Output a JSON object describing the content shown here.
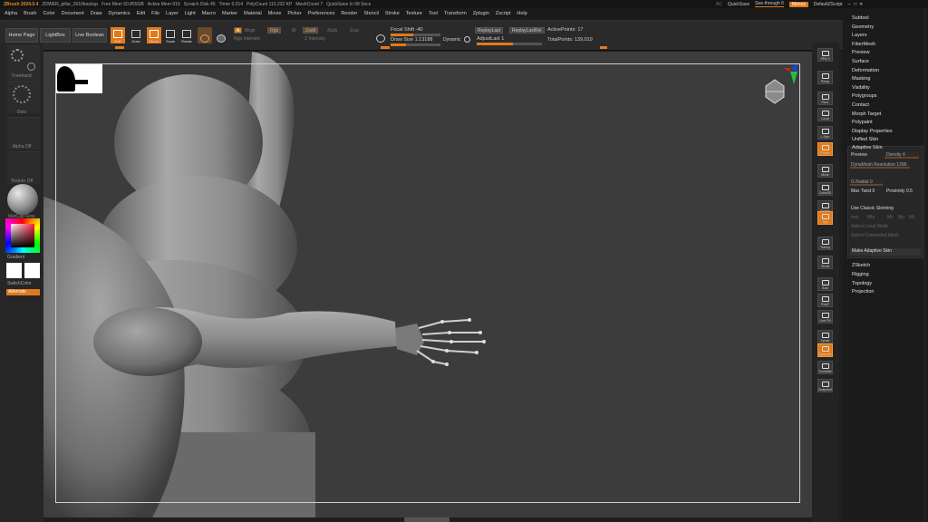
{
  "titlebar": {
    "app": "ZBrush 2024.0.4",
    "file": "ZDWER_pillar_0010backup",
    "free_mem": "Free Mem 50.855GB",
    "active_mem": "Active Mem 919",
    "scratch": "Scratch Disk 45",
    "timer": "Timer 0.014",
    "polycount": "PolyCount 113.232 KP",
    "meshcount": "MeshCount 7",
    "quicksave": "QuickSave In 58 Secs"
  },
  "topright": {
    "ac": "AC",
    "quicksave": "QuickSave",
    "seethrough": "See-through 0",
    "menus": "Menus",
    "script": "DefaultZScript"
  },
  "menubar": [
    "Alpha",
    "Brush",
    "Color",
    "Document",
    "Draw",
    "Dynamics",
    "Edit",
    "File",
    "Layer",
    "Light",
    "Macro",
    "Marker",
    "Material",
    "Movie",
    "Picker",
    "Preferences",
    "Render",
    "Stencil",
    "Stroke",
    "Texture",
    "Tool",
    "Transform",
    "Zplugin",
    "Zscript",
    "Help"
  ],
  "shelf": {
    "home_page": "Home Page",
    "lightbox": "LightBox",
    "live_boolean": "Live Boolean",
    "tools": [
      {
        "label": "Edit",
        "on": true
      },
      {
        "label": "Draw",
        "on": false
      },
      {
        "label": "Move",
        "on": true
      },
      {
        "label": "Scale",
        "on": false
      },
      {
        "label": "Rotate",
        "on": false
      }
    ],
    "mode_a": "A",
    "mrgb": "Mrgb",
    "rgb": "Rgb",
    "m": "M",
    "zadd": "Zadd",
    "zsub": "Zsub",
    "zcut": "Zcut",
    "rgb_intensity": "Rgb Intensity",
    "z_intensity": "Z Intensity",
    "focal_shift": "Focal Shift -40",
    "draw_size": "Draw Size 1.13188",
    "dynamic": "Dynamic",
    "replay_last": "ReplayLast",
    "replay_last_rel": "ReplayLastRel",
    "adjust_last": "AdjustLast 1",
    "active_points": "ActivePoints: 17",
    "total_points": "TotalPoints: 139,019",
    "focal_fill": 0.45,
    "draw_fill": 0.3,
    "adjust_fill": 0.55
  },
  "lefttray": {
    "stroke": "Freehand",
    "dots": "Dots",
    "alpha": "Alpha Off",
    "texture": "Texture Off",
    "material": "MatCap Gray",
    "gradient": "Gradient",
    "switch_color": "SwitchColor",
    "alternate": "Alternate"
  },
  "righticons": [
    {
      "label": "SPix 3",
      "on": false
    },
    {
      "label": "Persp",
      "on": false
    },
    {
      "label": "Floor",
      "on": false
    },
    {
      "label": "Local",
      "on": false
    },
    {
      "label": "L.Sym",
      "on": false
    },
    {
      "label": "Frame",
      "on": true
    },
    {
      "label": "Move",
      "on": false
    },
    {
      "label": "Zoom3D",
      "on": false
    },
    {
      "label": "Rotate",
      "on": false
    },
    {
      "label": "Xyz",
      "on": true
    },
    {
      "label": "Transp",
      "on": false
    },
    {
      "label": "Ghost",
      "on": false
    },
    {
      "label": "Solo",
      "on": false
    },
    {
      "label": "PolyF",
      "on": false
    },
    {
      "label": "Line Fill",
      "on": false
    },
    {
      "label": "Xpose",
      "on": false
    },
    {
      "label": "Dynamic",
      "on": true
    },
    {
      "label": "Turntable",
      "on": false
    },
    {
      "label": "Snapshot",
      "on": false
    }
  ],
  "rightpanel": {
    "items_top": [
      "Subtool",
      "Geometry",
      "Layers",
      "FiberMesh",
      "Preview",
      "Surface",
      "Deformation",
      "Masking",
      "Visibility",
      "Polygroups",
      "Contact",
      "Morph Target",
      "Polypaint",
      "Display Properties",
      "Unified Skin",
      "Adaptive Skin"
    ],
    "skin": {
      "preview": "Preview",
      "density": "Density 4",
      "dynamesh_res": "DynaMesh Resolution 1296",
      "g_radial": "G Radial 0",
      "max_twist": "Max Twist 0",
      "proximity": "Proximity 0.5",
      "classic": "Use Classic Skinning",
      "ires": "Ires",
      "mbr": "Mbr",
      "mc": "Mc",
      "mp": "Mp",
      "mc2": "Mc",
      "select_local": "Select Local Mesh",
      "select_connected": "Select Connected Mesh",
      "make": "Make Adaptive Skin"
    },
    "items_bottom": [
      "ZSketch",
      "Rigging",
      "Topology",
      "Projection"
    ]
  },
  "colors": {
    "accent": "#e07a1c",
    "viewport_bg": "#3c3c3c",
    "clay": "#9a9a9a"
  }
}
